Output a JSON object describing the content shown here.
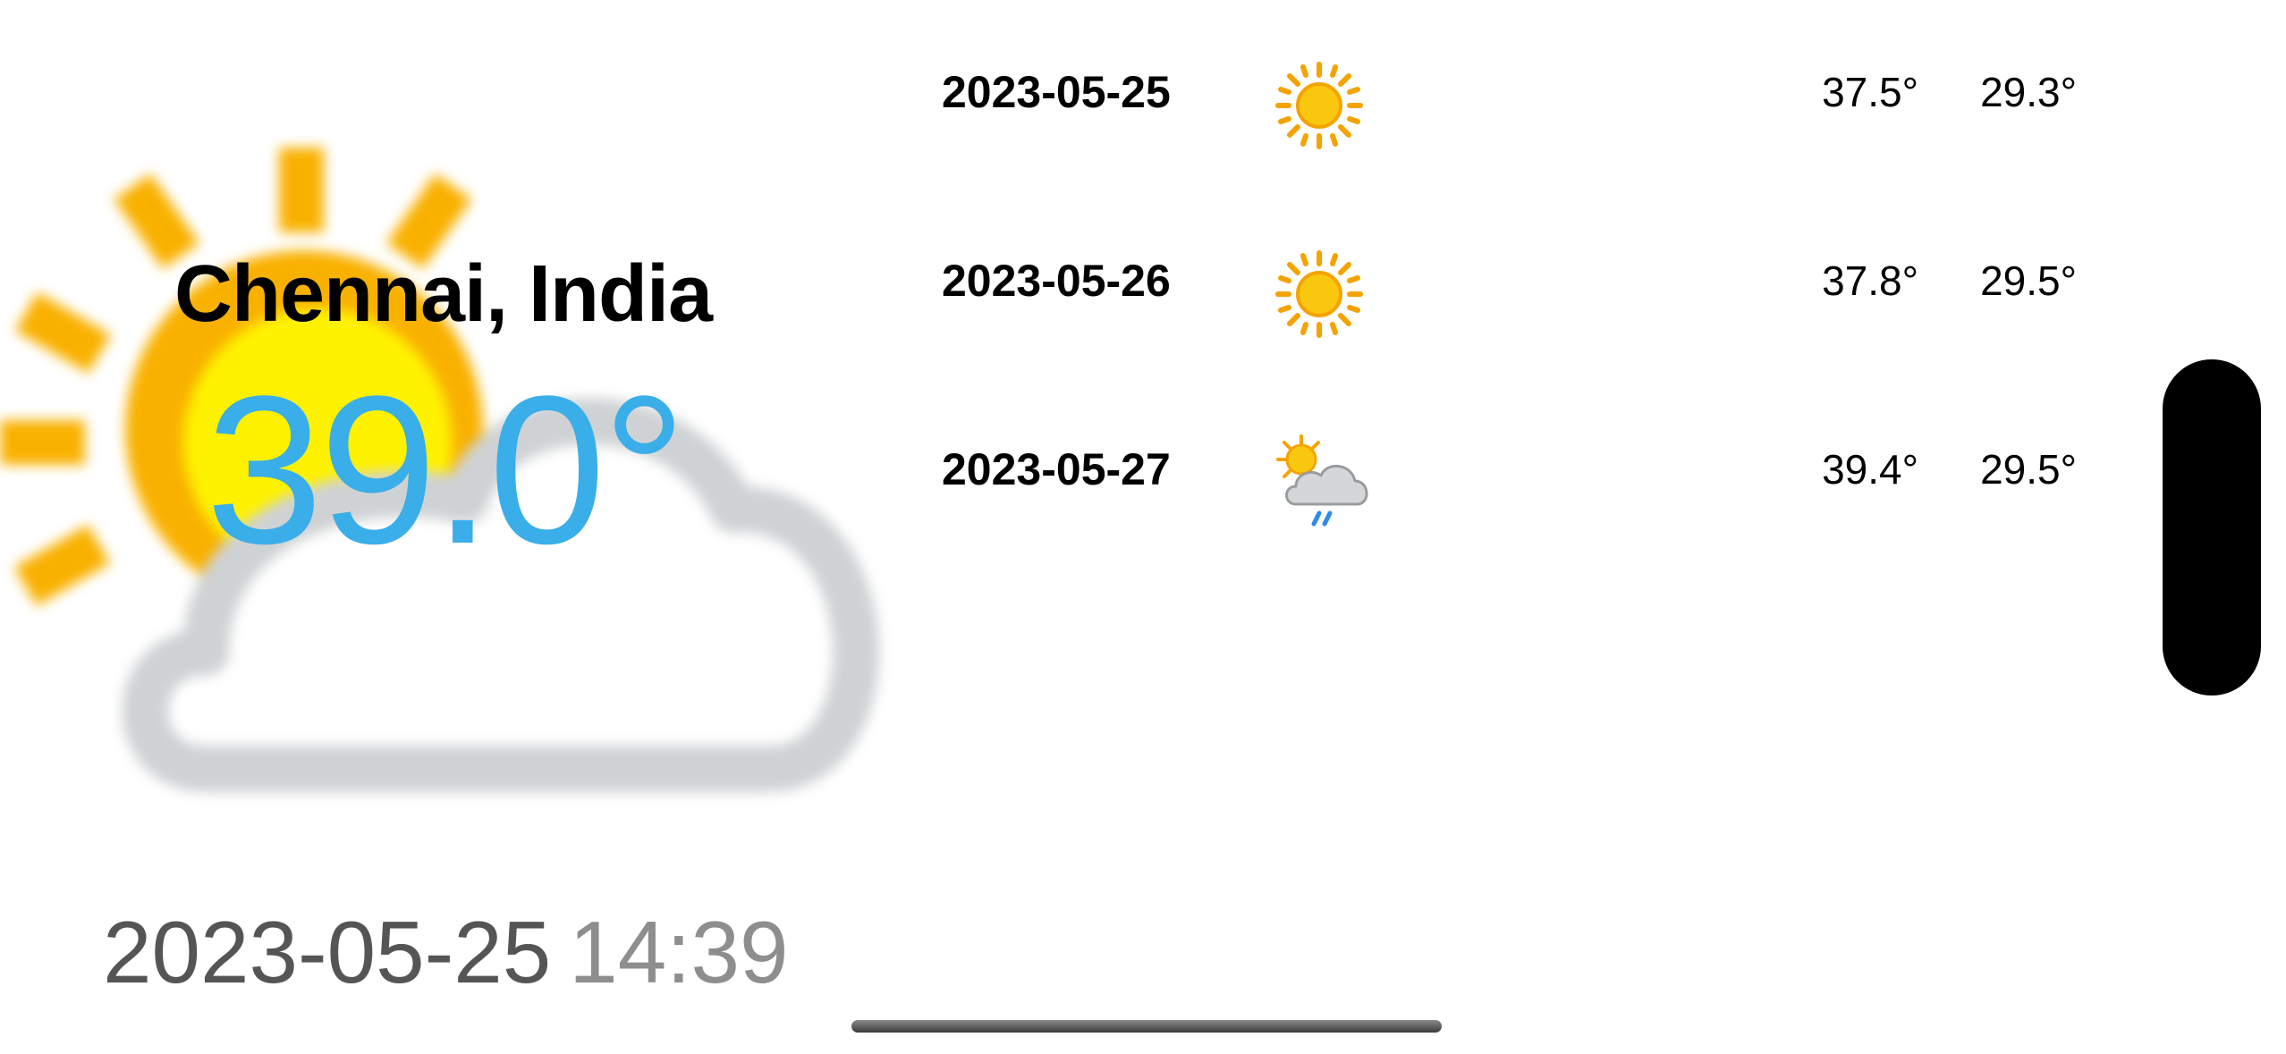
{
  "current": {
    "city": "Chennai, India",
    "temperature": "39.0°",
    "date": "2023-05-25",
    "time": "14:39",
    "condition_icon": "partly-cloudy-sun-icon"
  },
  "forecast": [
    {
      "date": "2023-05-25",
      "icon": "sun-icon",
      "high": "37.5°",
      "low": "29.3°"
    },
    {
      "date": "2023-05-26",
      "icon": "sun-icon",
      "high": "37.8°",
      "low": "29.5°"
    },
    {
      "date": "2023-05-27",
      "icon": "sun-cloud-rain-icon",
      "high": "39.4°",
      "low": "29.5°"
    }
  ],
  "colors": {
    "accent_temp": "#3aaee8",
    "sun": "#f9c80e",
    "sun_rays": "#f5a300",
    "cloud": "#cfd2d4",
    "rain": "#2e8be6"
  }
}
